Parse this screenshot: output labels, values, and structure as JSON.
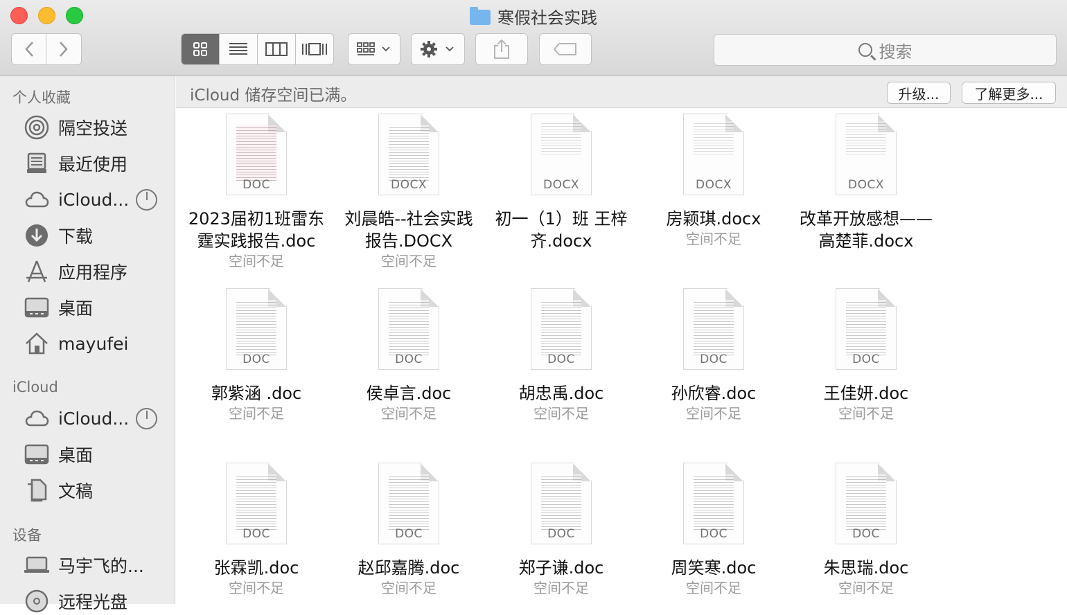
{
  "window": {
    "title": "寒假社会实践"
  },
  "toolbar": {
    "back_icon": "chevron-left-icon",
    "forward_icon": "chevron-right-icon",
    "view_modes": [
      "icon-view",
      "list-view",
      "column-view",
      "cover-flow-view"
    ],
    "active_view": "icon-view",
    "search_placeholder": "搜索"
  },
  "sidebar": {
    "favorites_header": "个人收藏",
    "favorites": [
      {
        "label": "隔空投送",
        "icon": "airdrop-icon"
      },
      {
        "label": "最近使用",
        "icon": "recents-icon"
      },
      {
        "label": "iCloud...",
        "icon": "icloud-icon"
      },
      {
        "label": "下载",
        "icon": "download-icon"
      },
      {
        "label": "应用程序",
        "icon": "applications-icon"
      },
      {
        "label": "桌面",
        "icon": "desktop-icon"
      },
      {
        "label": "mayufei",
        "icon": "home-icon"
      }
    ],
    "icloud_header": "iCloud",
    "icloud": [
      {
        "label": "iCloud...",
        "icon": "icloud-icon"
      },
      {
        "label": "桌面",
        "icon": "desktop-icon"
      },
      {
        "label": "文稿",
        "icon": "documents-icon"
      }
    ],
    "devices_header": "设备",
    "devices": [
      {
        "label": "马宇飞的...",
        "icon": "laptop-icon"
      },
      {
        "label": "远程光盘",
        "icon": "disc-icon"
      }
    ]
  },
  "banner": {
    "message": "iCloud 储存空间已满。",
    "upgrade_label": "升级...",
    "learn_more_label": "了解更多..."
  },
  "files": [
    {
      "name": "2023届初1班雷东霆实践报告.doc",
      "line1": "2023届初1班雷东",
      "line2": "霆实践报告.doc",
      "status": "空间不足",
      "ext": "DOC"
    },
    {
      "name": "刘晨皓--社会实践报告.DOCX",
      "line1": "刘晨皓--社会实践",
      "line2": "报告.DOCX",
      "status": "空间不足",
      "ext": "DOCX"
    },
    {
      "name": "初一（1）班 王梓齐.docx",
      "line1": "初一（1）班 王梓",
      "line2": "齐.docx",
      "status": "",
      "ext": "DOCX"
    },
    {
      "name": "房颖琪.docx",
      "line1": "房颖琪.docx",
      "line2": "",
      "status": "空间不足",
      "ext": "DOCX"
    },
    {
      "name": "改革开放感想——高楚菲.docx",
      "line1": "改革开放感想——",
      "line2": "高楚菲.docx",
      "status": "",
      "ext": "DOCX"
    },
    {
      "name": "郭紫涵 .doc",
      "line1": "郭紫涵 .doc",
      "line2": "",
      "status": "空间不足",
      "ext": "DOC"
    },
    {
      "name": "侯卓言.doc",
      "line1": "侯卓言.doc",
      "line2": "",
      "status": "空间不足",
      "ext": "DOC"
    },
    {
      "name": "胡忠禹.doc",
      "line1": "胡忠禹.doc",
      "line2": "",
      "status": "空间不足",
      "ext": "DOC"
    },
    {
      "name": "孙欣睿.doc",
      "line1": "孙欣睿.doc",
      "line2": "",
      "status": "空间不足",
      "ext": "DOC"
    },
    {
      "name": "王佳妍.doc",
      "line1": "王佳妍.doc",
      "line2": "",
      "status": "空间不足",
      "ext": "DOC"
    },
    {
      "name": "张霖凯.doc",
      "line1": "张霖凯.doc",
      "line2": "",
      "status": "空间不足",
      "ext": "DOC"
    },
    {
      "name": "赵邱嘉腾.doc",
      "line1": "赵邱嘉腾.doc",
      "line2": "",
      "status": "空间不足",
      "ext": "DOC"
    },
    {
      "name": "郑子谦.doc",
      "line1": "郑子谦.doc",
      "line2": "",
      "status": "空间不足",
      "ext": "DOC"
    },
    {
      "name": "周笑寒.doc",
      "line1": "周笑寒.doc",
      "line2": "",
      "status": "空间不足",
      "ext": "DOC"
    },
    {
      "name": "朱思瑞.doc",
      "line1": "朱思瑞.doc",
      "line2": "",
      "status": "空间不足",
      "ext": "DOC"
    }
  ]
}
